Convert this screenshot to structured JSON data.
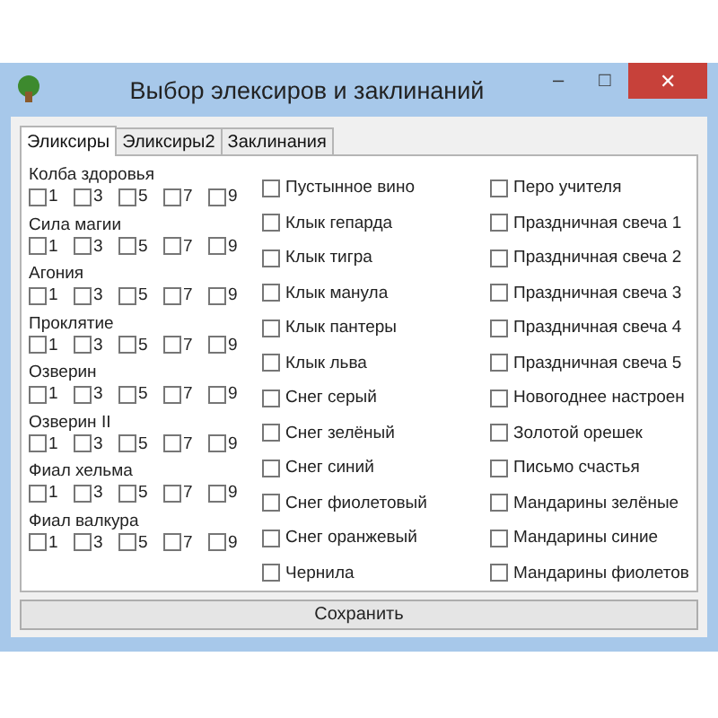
{
  "window": {
    "title": "Выбор элексиров и заклинаний",
    "controls": [
      {
        "kind": "minimize",
        "label": "–"
      },
      {
        "kind": "maximize",
        "label": "□"
      },
      {
        "kind": "close",
        "label": "✕"
      }
    ]
  },
  "tabs": [
    {
      "label": "Эликсиры",
      "selected": true
    },
    {
      "label": "Эликсиры2",
      "selected": false
    },
    {
      "label": "Заклинания",
      "selected": false
    }
  ],
  "elixirs": [
    {
      "name": "Колба здоровья",
      "levels": [
        {
          "label": "1",
          "checked": false
        },
        {
          "label": "3",
          "checked": false
        },
        {
          "label": "5",
          "checked": false
        },
        {
          "label": "7",
          "checked": false
        },
        {
          "label": "9",
          "checked": false
        }
      ]
    },
    {
      "name": "Сила магии",
      "levels": [
        {
          "label": "1",
          "checked": false
        },
        {
          "label": "3",
          "checked": false
        },
        {
          "label": "5",
          "checked": false
        },
        {
          "label": "7",
          "checked": false
        },
        {
          "label": "9",
          "checked": false
        }
      ]
    },
    {
      "name": "Агония",
      "levels": [
        {
          "label": "1",
          "checked": false
        },
        {
          "label": "3",
          "checked": false
        },
        {
          "label": "5",
          "checked": false
        },
        {
          "label": "7",
          "checked": false
        },
        {
          "label": "9",
          "checked": false
        }
      ]
    },
    {
      "name": "Проклятие",
      "levels": [
        {
          "label": "1",
          "checked": false
        },
        {
          "label": "3",
          "checked": false
        },
        {
          "label": "5",
          "checked": false
        },
        {
          "label": "7",
          "checked": false
        },
        {
          "label": "9",
          "checked": false
        }
      ]
    },
    {
      "name": "Озверин",
      "levels": [
        {
          "label": "1",
          "checked": false
        },
        {
          "label": "3",
          "checked": false
        },
        {
          "label": "5",
          "checked": false
        },
        {
          "label": "7",
          "checked": false
        },
        {
          "label": "9",
          "checked": false
        }
      ]
    },
    {
      "name": "Озверин II",
      "levels": [
        {
          "label": "1",
          "checked": false
        },
        {
          "label": "3",
          "checked": false
        },
        {
          "label": "5",
          "checked": false
        },
        {
          "label": "7",
          "checked": false
        },
        {
          "label": "9",
          "checked": false
        }
      ]
    },
    {
      "name": "Фиал хельма",
      "levels": [
        {
          "label": "1",
          "checked": false
        },
        {
          "label": "3",
          "checked": false
        },
        {
          "label": "5",
          "checked": false
        },
        {
          "label": "7",
          "checked": false
        },
        {
          "label": "9",
          "checked": false
        }
      ]
    },
    {
      "name": "Фиал валкура",
      "levels": [
        {
          "label": "1",
          "checked": false
        },
        {
          "label": "3",
          "checked": false
        },
        {
          "label": "5",
          "checked": false
        },
        {
          "label": "7",
          "checked": false
        },
        {
          "label": "9",
          "checked": false
        }
      ]
    }
  ],
  "items_column_1": [
    {
      "label": "Пустынное вино",
      "checked": false
    },
    {
      "label": "Клык гепарда",
      "checked": false
    },
    {
      "label": "Клык тигра",
      "checked": false
    },
    {
      "label": "Клык манула",
      "checked": false
    },
    {
      "label": "Клык пантеры",
      "checked": false
    },
    {
      "label": "Клык льва",
      "checked": false
    },
    {
      "label": "Снег серый",
      "checked": false
    },
    {
      "label": "Снег зелёный",
      "checked": false
    },
    {
      "label": "Снег синий",
      "checked": false
    },
    {
      "label": "Снег фиолетовый",
      "checked": false
    },
    {
      "label": "Снег оранжевый",
      "checked": false
    },
    {
      "label": "Чернила",
      "checked": false
    }
  ],
  "items_column_2": [
    {
      "label": "Перо учителя",
      "checked": false
    },
    {
      "label": "Праздничная свеча 1",
      "checked": false
    },
    {
      "label": "Праздничная свеча 2",
      "checked": false
    },
    {
      "label": "Праздничная свеча 3",
      "checked": false
    },
    {
      "label": "Праздничная свеча 4",
      "checked": false
    },
    {
      "label": "Праздничная свеча 5",
      "checked": false
    },
    {
      "label": "Новогоднее настроен",
      "checked": false
    },
    {
      "label": "Золотой орешек",
      "checked": false
    },
    {
      "label": "Письмо счастья",
      "checked": false
    },
    {
      "label": "Мандарины зелёные",
      "checked": false
    },
    {
      "label": "Мандарины синие",
      "checked": false
    },
    {
      "label": "Мандарины фиолетов",
      "checked": false
    }
  ],
  "save_button": "Сохранить"
}
